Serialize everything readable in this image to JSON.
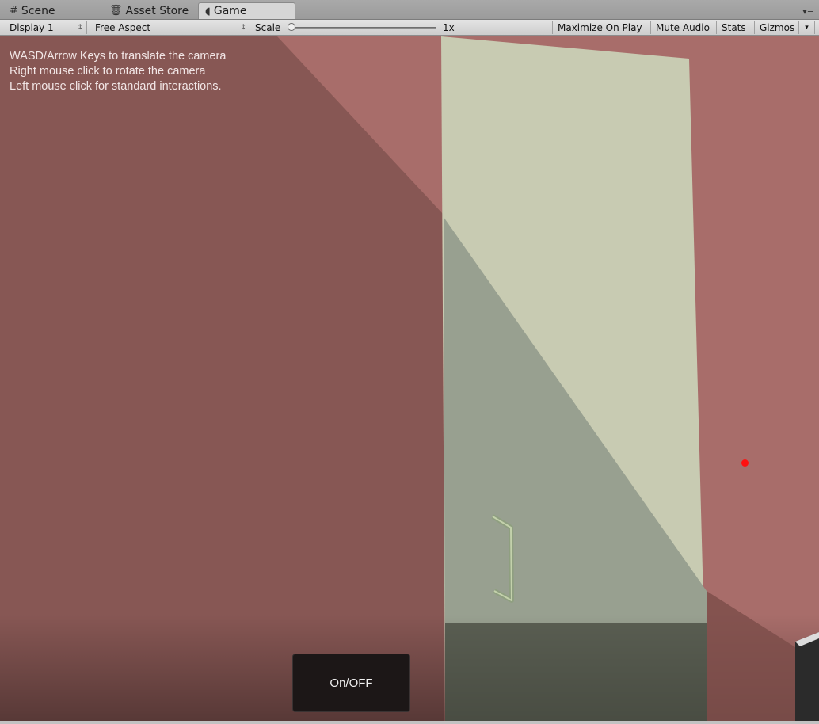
{
  "tabs": [
    {
      "label": "Scene",
      "icon": "hash-icon",
      "active": false
    },
    {
      "label": "Asset Store",
      "icon": "store-icon",
      "active": false
    },
    {
      "label": "Game",
      "icon": "pacman-icon",
      "active": true
    }
  ],
  "toolbar": {
    "display": "Display 1",
    "aspect": "Free Aspect",
    "scale_label": "Scale",
    "scale_value": "1x",
    "maximize_on_play": "Maximize On Play",
    "mute_audio": "Mute Audio",
    "stats": "Stats",
    "gizmos": "Gizmos"
  },
  "game": {
    "instructions": [
      "WASD/Arrow Keys to translate the camera",
      "Right mouse click to rotate the camera",
      "Left mouse click for standard interactions."
    ],
    "button_label": "On/OFF"
  },
  "colors": {
    "wall": "#a86d6a",
    "shadow": "#875754",
    "door_lit": "#c8cbb2",
    "door_shadow": "#98a090",
    "cursor_dot": "#ff1010"
  }
}
